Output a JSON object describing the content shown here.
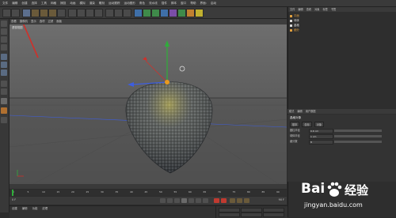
{
  "menubar": {
    "items": [
      "文件",
      "编辑",
      "创建",
      "选择",
      "工具",
      "网格",
      "捕捉",
      "动画",
      "模拟",
      "渲染",
      "雕刻",
      "运动跟踪",
      "运动图形",
      "角色",
      "流水线",
      "插件",
      "脚本",
      "窗口",
      "帮助",
      "界面:",
      "启动"
    ]
  },
  "viewport": {
    "menu": [
      "查看",
      "摄像机",
      "显示",
      "选项",
      "过滤",
      "面板"
    ],
    "label": "透视视图",
    "footer_left": "",
    "footer_right": ""
  },
  "timeline": {
    "ticks": [
      "0",
      "5",
      "10",
      "15",
      "20",
      "25",
      "30",
      "35",
      "40",
      "45",
      "50",
      "55",
      "60",
      "65",
      "70",
      "75",
      "80",
      "85",
      "90"
    ],
    "start_frame": "0 F",
    "end_frame": "90 F"
  },
  "materials": {
    "tabs": [
      "创建",
      "编辑",
      "功能",
      "纹理"
    ]
  },
  "objects": {
    "tabs": [
      "文件",
      "编辑",
      "查看",
      "对象",
      "标签",
      "书签"
    ],
    "rows": [
      {
        "name": "平面",
        "color": "#e0a040"
      },
      {
        "name": "球体",
        "color": "#d8d8d8"
      },
      {
        "name": "晶格",
        "color": "#d8d8d8"
      },
      {
        "name": "细分",
        "color": "#e0a040"
      }
    ]
  },
  "attributes": {
    "tabs": [
      "模式",
      "编辑",
      "用户数据"
    ],
    "title": "晶格对象",
    "sections": [
      "基本",
      "坐标",
      "对象"
    ],
    "params": [
      {
        "label": "圆柱半径",
        "value": "0.6 cm"
      },
      {
        "label": "球体半径",
        "value": "1 cm"
      },
      {
        "label": "细分数",
        "value": "8"
      }
    ]
  },
  "watermark": {
    "brand": "Bai",
    "brand_cn": "经验",
    "url": "jingyan.baidu.com"
  },
  "colors": {
    "accent_red": "#d0302a",
    "axis_green": "#2fae3a",
    "axis_blue": "#3d5ee0"
  }
}
